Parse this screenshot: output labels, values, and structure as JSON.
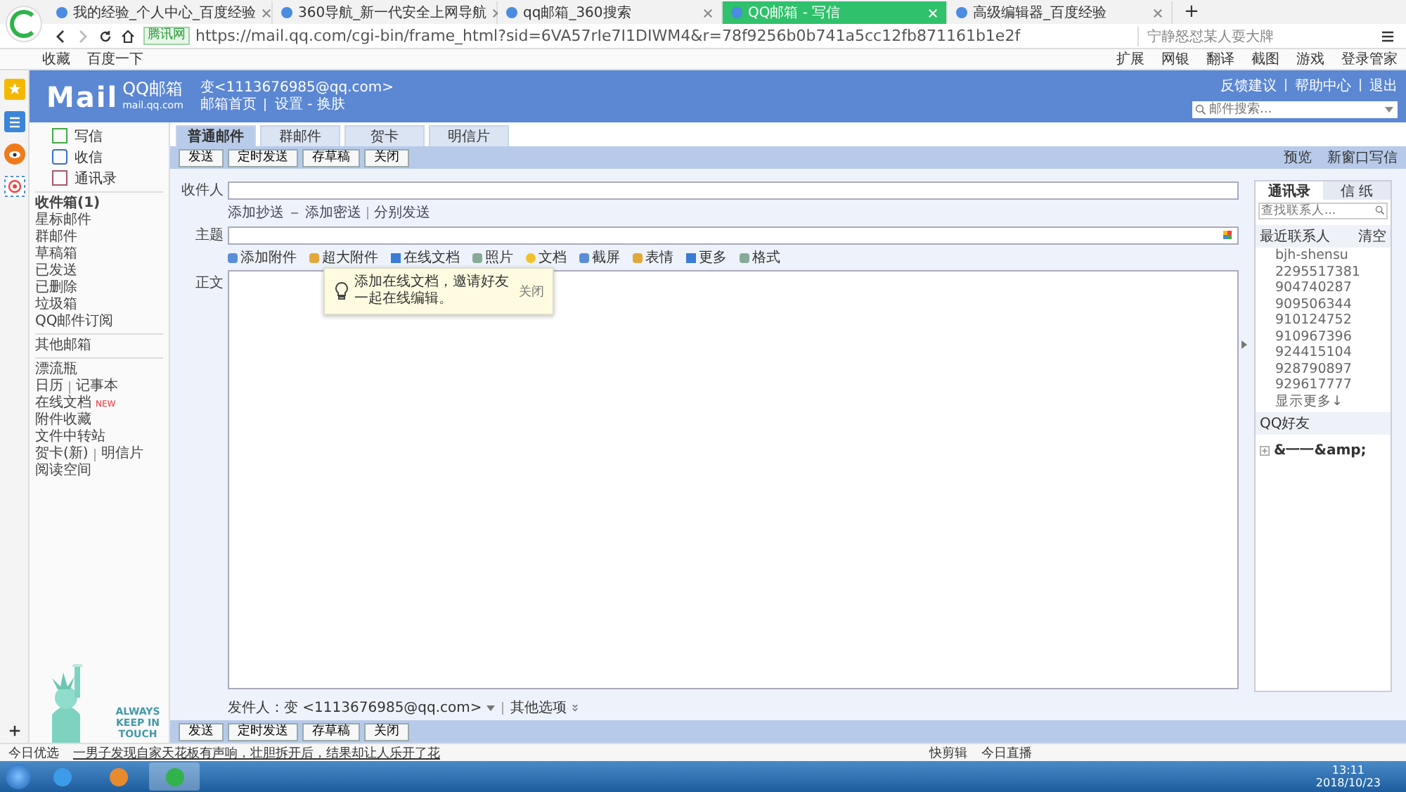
{
  "browser": {
    "tabs": [
      {
        "label": "我的经验_个人中心_百度经验",
        "selected": false
      },
      {
        "label": "360导航_新一代安全上网导航",
        "selected": false
      },
      {
        "label": "qq邮箱_360搜索",
        "selected": false
      },
      {
        "label": "QQ邮箱 - 写信",
        "selected": true
      },
      {
        "label": "高级编辑器_百度经验",
        "selected": false
      }
    ],
    "new_tab": "+",
    "site_badge": "腾讯网",
    "url": "https://mail.qq.com/cgi-bin/frame_html?sid=6VA57rIe7I1DIWM4&r=78f9256b0b741a5cc12fb871161b1e2f",
    "search_hint": "宁静怒怼某人耍大牌",
    "bookmarks": [
      "收藏",
      "百度一下"
    ],
    "tools": [
      "扩展",
      "网银",
      "翻译",
      "截图",
      "游戏",
      "登录管家"
    ]
  },
  "header": {
    "logo": "Mail",
    "brand": "QQ邮箱",
    "domain": "mail.qq.com",
    "account": "变<1113676985@qq.com>",
    "links": [
      "邮箱首页",
      "设置 - 换肤"
    ],
    "top_links": [
      "反馈建议",
      "帮助中心",
      "退出"
    ],
    "search": {
      "placeholder": "邮件搜索..."
    }
  },
  "nav": {
    "main": [
      "写信",
      "收信",
      "通讯录"
    ],
    "folders": [
      {
        "label": "收件箱(1)",
        "bold": true
      },
      {
        "label": "星标邮件",
        "bold": false
      },
      {
        "label": "群邮件",
        "bold": false
      },
      {
        "label": "草稿箱",
        "bold": false
      },
      {
        "label": "已发送",
        "bold": false
      },
      {
        "label": "已删除",
        "bold": false
      },
      {
        "label": "垃圾箱",
        "bold": false
      },
      {
        "label": "QQ邮件订阅",
        "bold": false
      }
    ],
    "other": "其他邮箱",
    "apps": [
      [
        "漂流瓶"
      ],
      [
        "日历",
        "记事本"
      ],
      [
        "在线文档"
      ],
      [
        "附件收藏"
      ],
      [
        "文件中转站"
      ],
      [
        "贺卡(新)",
        "明信片"
      ],
      [
        "阅读空间"
      ]
    ],
    "new_badge": "NEW",
    "slogan": "ALWAYS KEEP IN TOUCH"
  },
  "compose": {
    "tabs": [
      {
        "label": "普通邮件",
        "selected": true
      },
      {
        "label": "群邮件",
        "selected": false
      },
      {
        "label": "贺卡",
        "selected": false
      },
      {
        "label": "明信片",
        "selected": false
      }
    ],
    "buttons": [
      "发送",
      "定时发送",
      "存草稿",
      "关闭"
    ],
    "bottom_buttons": [
      "发送",
      "定时发送",
      "存草稿",
      "关闭"
    ],
    "right_links": [
      "预览",
      "新窗口写信"
    ],
    "to_label": "收件人",
    "cc_links": [
      "添加抄送",
      "添加密送",
      "分别发送"
    ],
    "subject_label": "主题",
    "toolbar": [
      "添加附件",
      "超大附件",
      "在线文档",
      "照片",
      "文档",
      "截屏",
      "表情",
      "更多",
      "格式"
    ],
    "body_label": "正文",
    "tip": {
      "text": "添加在线文档，邀请好友一起在线编辑。",
      "close": "关闭"
    },
    "sender_label": "发件人：",
    "sender": "变 <1113676985@qq.com>",
    "more_options": "其他选项"
  },
  "contacts": {
    "tabs": [
      {
        "label": "通讯录",
        "selected": true
      },
      {
        "label": "信 纸",
        "selected": false
      }
    ],
    "search": {
      "placeholder": "查找联系人..."
    },
    "recent": "最近联系人",
    "clear": "清空",
    "items": [
      "bjh-shensu",
      "2295517381",
      "904740287",
      "909506344",
      "910124752",
      "910967396",
      "924415104",
      "928790897",
      "929617777"
    ],
    "show_more": "显示更多↓",
    "friends": "QQ好友",
    "group": "&一一&amp;"
  },
  "status_bar": {
    "label": "今日优选",
    "news": "一男子发现自家天花板有声响，壮胆拆开后，结果却让人乐开了花",
    "items": [
      "快剪辑",
      "今日直播"
    ]
  },
  "taskbar": {
    "time": "13:11",
    "date": "2018/10/23"
  }
}
